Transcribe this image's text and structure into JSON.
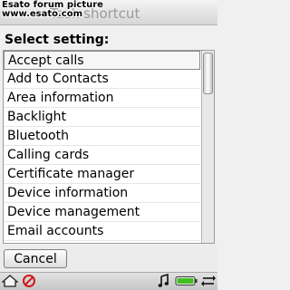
{
  "watermark": {
    "line1": "Esato forum picture",
    "line2": "www.esato.com"
  },
  "title": "Task shortcut",
  "heading": "Select setting:",
  "list": {
    "selected_index": 0,
    "items": [
      {
        "label": "Accept calls"
      },
      {
        "label": "Add to Contacts"
      },
      {
        "label": "Area information"
      },
      {
        "label": "Backlight"
      },
      {
        "label": "Bluetooth"
      },
      {
        "label": "Calling cards"
      },
      {
        "label": "Certificate manager"
      },
      {
        "label": "Device information"
      },
      {
        "label": "Device management"
      },
      {
        "label": "Email accounts"
      }
    ]
  },
  "softkeys": {
    "cancel_label": "Cancel"
  },
  "statusbar": {
    "icons": [
      "home-icon",
      "no-signal-icon",
      "music-note-icon",
      "battery-icon",
      "data-transfer-icon"
    ]
  },
  "colors": {
    "battery_fill": "#3fbf1f",
    "no_signal": "#d01818"
  }
}
